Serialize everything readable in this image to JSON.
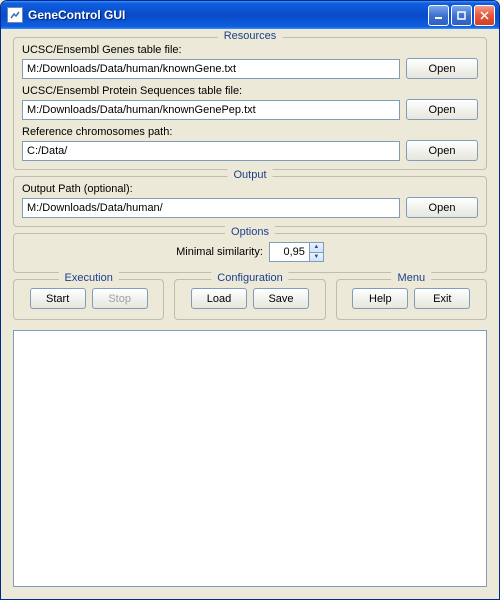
{
  "window": {
    "title": "GeneControl GUI"
  },
  "resources": {
    "legend": "Resources",
    "genes_label": "UCSC/Ensembl Genes table file:",
    "genes_value": "M:/Downloads/Data/human/knownGene.txt",
    "protein_label": "UCSC/Ensembl Protein Sequences table file:",
    "protein_value": "M:/Downloads/Data/human/knownGenePep.txt",
    "chrom_label": "Reference chromosomes path:",
    "chrom_value": "C:/Data/",
    "open_label": "Open"
  },
  "output": {
    "legend": "Output",
    "path_label": "Output Path (optional):",
    "path_value": "M:/Downloads/Data/human/",
    "open_label": "Open"
  },
  "options": {
    "legend": "Options",
    "min_sim_label": "Minimal similarity:",
    "min_sim_value": "0,95"
  },
  "execution": {
    "legend": "Execution",
    "start_label": "Start",
    "stop_label": "Stop"
  },
  "configuration": {
    "legend": "Configuration",
    "load_label": "Load",
    "save_label": "Save"
  },
  "menu": {
    "legend": "Menu",
    "help_label": "Help",
    "exit_label": "Exit"
  }
}
